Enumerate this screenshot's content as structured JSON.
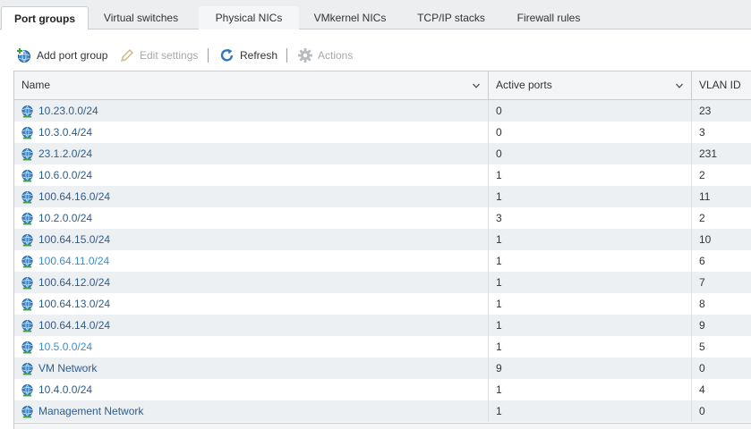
{
  "tabs": [
    {
      "label": "Port groups",
      "active": true
    },
    {
      "label": "Virtual switches",
      "active": false
    },
    {
      "label": "Physical NICs",
      "active": false
    },
    {
      "label": "VMkernel NICs",
      "active": false
    },
    {
      "label": "TCP/IP stacks",
      "active": false
    },
    {
      "label": "Firewall rules",
      "active": false
    }
  ],
  "toolbar": {
    "add_label": "Add port group",
    "edit_label": "Edit settings",
    "refresh_label": "Refresh",
    "actions_label": "Actions"
  },
  "table": {
    "columns": [
      "Name",
      "Active ports",
      "VLAN ID"
    ],
    "rows": [
      {
        "name": "10.23.0.0/24",
        "active_ports": "0",
        "vlan": "23"
      },
      {
        "name": "10.3.0.4/24",
        "active_ports": "0",
        "vlan": "3"
      },
      {
        "name": "23.1.2.0/24",
        "active_ports": "0",
        "vlan": "231"
      },
      {
        "name": "10.6.0.0/24",
        "active_ports": "1",
        "vlan": "2"
      },
      {
        "name": "100.64.16.0/24",
        "active_ports": "1",
        "vlan": "11"
      },
      {
        "name": "10.2.0.0/24",
        "active_ports": "3",
        "vlan": "2"
      },
      {
        "name": "100.64.15.0/24",
        "active_ports": "1",
        "vlan": "10"
      },
      {
        "name": "100.64.11.0/24",
        "active_ports": "1",
        "vlan": "6"
      },
      {
        "name": "100.64.12.0/24",
        "active_ports": "1",
        "vlan": "7"
      },
      {
        "name": "100.64.13.0/24",
        "active_ports": "1",
        "vlan": "8"
      },
      {
        "name": "100.64.14.0/24",
        "active_ports": "1",
        "vlan": "9"
      },
      {
        "name": "10.5.0.0/24",
        "active_ports": "1",
        "vlan": "5"
      },
      {
        "name": "VM Network",
        "active_ports": "9",
        "vlan": "0"
      },
      {
        "name": "10.4.0.0/24",
        "active_ports": "1",
        "vlan": "4"
      },
      {
        "name": "Management Network",
        "active_ports": "1",
        "vlan": "0"
      }
    ]
  },
  "icons": {
    "row_icon": "network-globe-icon",
    "add_icon": "add-port-group-icon",
    "edit_icon": "pencil-icon",
    "refresh_icon": "refresh-icon",
    "actions_icon": "gear-icon",
    "sort_icon": "chevron-down-icon"
  },
  "colors": {
    "link": "#2c5d8a",
    "link_visited": "#3a8ec9",
    "row_alt": "#edf0f3",
    "tabbar": "#eceef0"
  }
}
